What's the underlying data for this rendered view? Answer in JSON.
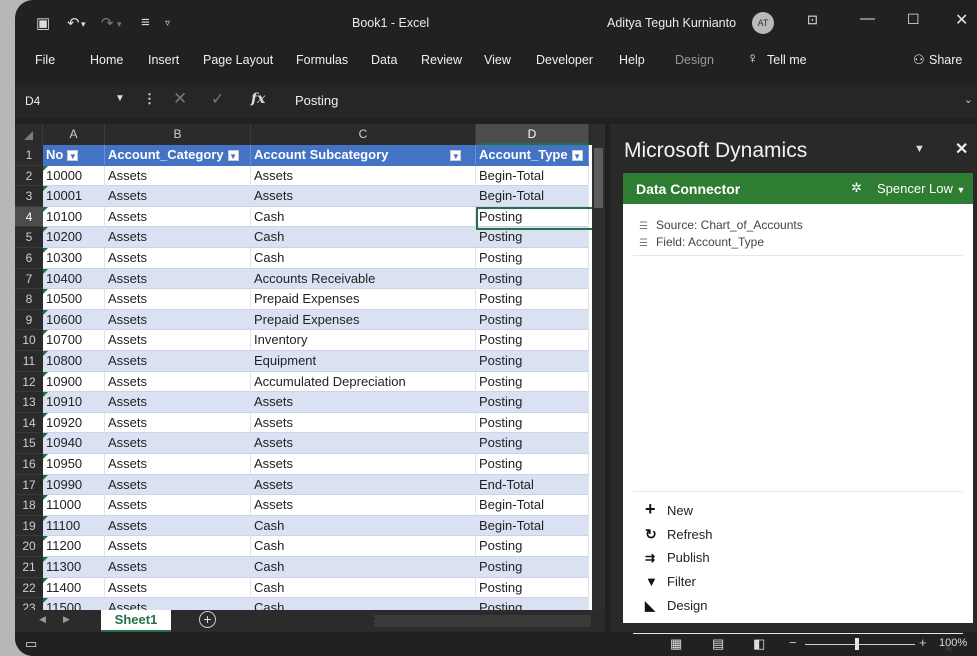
{
  "window": {
    "doc_title": "Book1  -  Excel",
    "user": "Aditya Teguh Kurnianto",
    "avatar_initials": "AT"
  },
  "ribbon_tabs": [
    "File",
    "Home",
    "Insert",
    "Page Layout",
    "Formulas",
    "Data",
    "Review",
    "View",
    "Developer",
    "Help",
    "Design"
  ],
  "ribbon_extra": {
    "tell_me": "Tell me",
    "share": "Share"
  },
  "formula_bar": {
    "name_box": "D4",
    "fx": "fx",
    "content": "Posting"
  },
  "grid": {
    "column_letters": [
      "A",
      "B",
      "C",
      "D"
    ],
    "selected_column": "D",
    "selected_row": 4,
    "row_numbers": [
      1,
      2,
      3,
      4,
      5,
      6,
      7,
      8,
      9,
      10,
      11,
      12,
      13,
      14,
      15,
      16,
      17,
      18,
      19,
      20,
      21,
      22,
      23
    ],
    "headers": [
      "No",
      "Account_Category",
      "Account Subcategory",
      "Account_Type"
    ],
    "rows": [
      [
        "10000",
        "Assets",
        "Assets",
        "Begin-Total"
      ],
      [
        "10001",
        "Assets",
        "Assets",
        "Begin-Total"
      ],
      [
        "10100",
        "Assets",
        "Cash",
        "Posting"
      ],
      [
        "10200",
        "Assets",
        "Cash",
        "Posting"
      ],
      [
        "10300",
        "Assets",
        "Cash",
        "Posting"
      ],
      [
        "10400",
        "Assets",
        "Accounts Receivable",
        "Posting"
      ],
      [
        "10500",
        "Assets",
        "Prepaid Expenses",
        "Posting"
      ],
      [
        "10600",
        "Assets",
        "Prepaid Expenses",
        "Posting"
      ],
      [
        "10700",
        "Assets",
        "Inventory",
        "Posting"
      ],
      [
        "10800",
        "Assets",
        "Equipment",
        "Posting"
      ],
      [
        "10900",
        "Assets",
        "Accumulated Depreciation",
        "Posting"
      ],
      [
        "10910",
        "Assets",
        "Assets",
        "Posting"
      ],
      [
        "10920",
        "Assets",
        "Assets",
        "Posting"
      ],
      [
        "10940",
        "Assets",
        "Assets",
        "Posting"
      ],
      [
        "10950",
        "Assets",
        "Assets",
        "Posting"
      ],
      [
        "10990",
        "Assets",
        "Assets",
        "End-Total"
      ],
      [
        "11000",
        "Assets",
        "Assets",
        "Begin-Total"
      ],
      [
        "11100",
        "Assets",
        "Cash",
        "Begin-Total"
      ],
      [
        "11200",
        "Assets",
        "Cash",
        "Posting"
      ],
      [
        "11300",
        "Assets",
        "Cash",
        "Posting"
      ],
      [
        "11400",
        "Assets",
        "Cash",
        "Posting"
      ],
      [
        "11500",
        "Assets",
        "Cash",
        "Posting"
      ]
    ]
  },
  "sheet_tabs": {
    "active": "Sheet1"
  },
  "status": {
    "zoom": "100%"
  },
  "pane": {
    "title": "Microsoft Dynamics",
    "addin": {
      "title": "Data Connector",
      "user": "Spencer Low",
      "source": "Source: Chart_of_Accounts",
      "field": "Field: Account_Type",
      "actions": [
        {
          "icon": "plus-icon",
          "label": "New"
        },
        {
          "icon": "refresh-icon",
          "label": "Refresh"
        },
        {
          "icon": "publish-icon",
          "label": "Publish"
        },
        {
          "icon": "filter-icon",
          "label": "Filter"
        },
        {
          "icon": "design-icon",
          "label": "Design"
        }
      ]
    }
  },
  "colors": {
    "excel_green": "#217346",
    "table_header": "#4472c4",
    "band": "#d9e1f2",
    "addin_header": "#2e7d32"
  }
}
